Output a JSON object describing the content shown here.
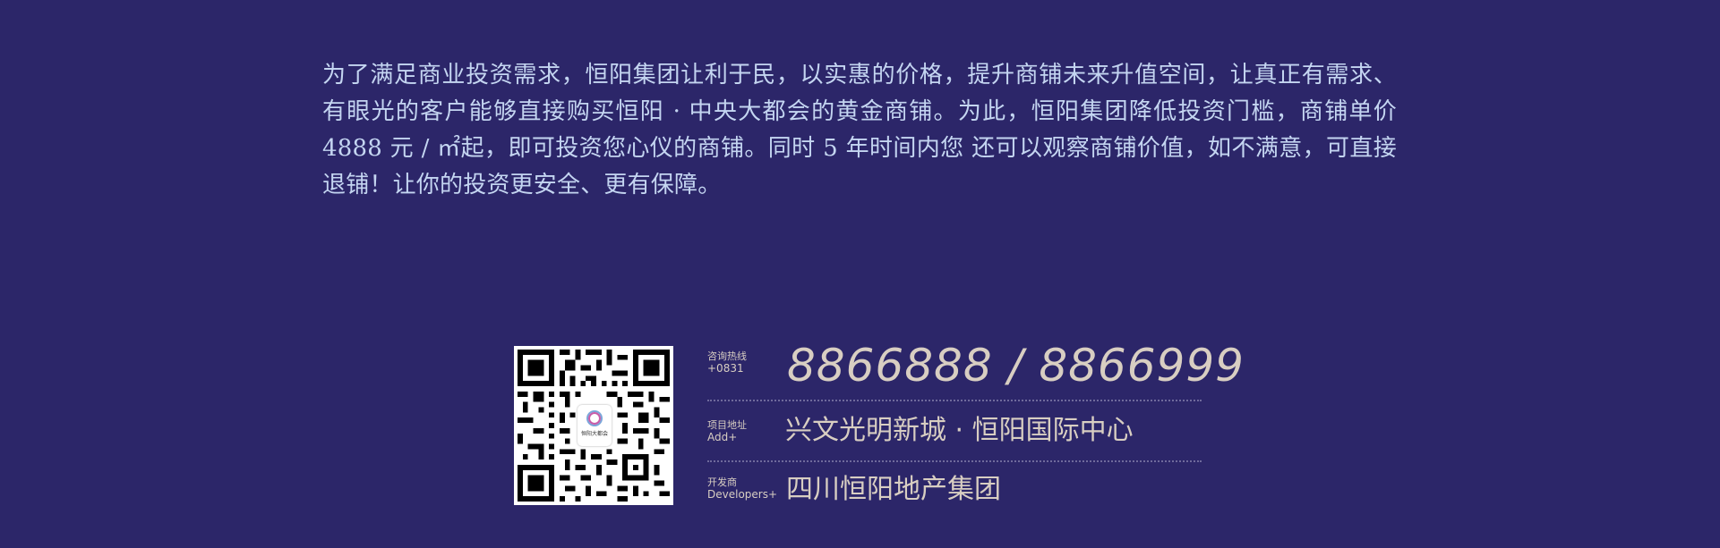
{
  "intro": {
    "text": "为了满足商业投资需求，恒阳集团让利于民，以实惠的价格，提升商铺未来升值空间，让真正有需求、有眼光的客户能够直接购买恒阳 · 中央大都会的黄金商铺。为此，恒阳集团降低投资门槛，商铺单价 4888 元 / ㎡起，即可投资您心仪的商铺。同时 5 年时间内您 还可以观察商铺价值，如不满意，可直接退铺！让你的投资更安全、更有保障。"
  },
  "qr": {
    "logo_text": "恒阳大都会"
  },
  "contact": {
    "hotline_label_cn": "咨询热线",
    "hotline_label_en": "+0831",
    "hotline_value": "8866888 / 8866999",
    "address_label_cn": "项目地址",
    "address_label_en": "Add+",
    "address_value": "兴文光明新城 · 恒阳国际中心",
    "developer_label_cn": "开发商",
    "developer_label_en": "Developers+",
    "developer_value": "四川恒阳地产集团"
  },
  "colors": {
    "background": "#2c2669",
    "intro_text": "#c4d5f1",
    "contact_text": "#d8cec2"
  }
}
